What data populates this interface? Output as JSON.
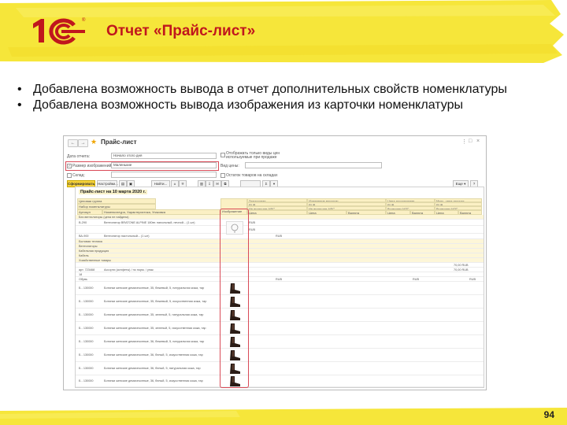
{
  "slide": {
    "title": "Отчет «Прайс-лист»",
    "bullets": [
      "Добавлена возможность вывода в отчет дополнительных свойств номенклатуры",
      "Добавлена возможность вывода изображения из карточки номенклатуры"
    ],
    "page_number": "94"
  },
  "colors": {
    "title": "#c0171d",
    "highlight_band": "#f6e63a",
    "logo_red": "#c0171d",
    "annotation": "#d94a57"
  },
  "logo": {
    "text": "1С"
  },
  "window": {
    "title": "Прайс-лист",
    "nav": {
      "back": "←",
      "forward": "→"
    },
    "controls": {
      "menu": "⋮",
      "restore": "□",
      "close": "×"
    },
    "filters": {
      "date_label": "Дата отчета:",
      "date_value": "Начало этого дня",
      "image_size_label": "Размер изображений:",
      "image_size_value": "Маленькие",
      "warehouse_label": "Склад:",
      "option1": "Отображать только виды цен используемые при продаже",
      "price_type_label": "Вид цены:",
      "option2": "Остаток товаров на складах"
    },
    "toolbar": {
      "generate": "Сформировать",
      "settings": "Настройки...",
      "find": "Найти...",
      "sum_symbol": "Σ",
      "more": "Еще ▾",
      "help": "?"
    },
    "report": {
      "title": "Прайс-лист на 10 марта 2020 г.",
      "headers": {
        "c1": [
          "Ценовая группа",
          "Набор номенклатуры",
          "Артикул"
        ],
        "c2": [
          "",
          "",
          "Номенклатура, Характеристика, Упаковка"
        ],
        "c3": [
          "",
          "",
          "Изображение"
        ],
        "c4": [
          "Закупочная",
          "RUB",
          "Не включает НДС",
          "Цена"
        ],
        "c5": [
          "Изменение вручную",
          "RUB",
          "Не включает НДС",
          "Цена"
        ],
        "c6": [
          "",
          "",
          "",
          "Валюта"
        ],
        "c7": [
          "Цена поступления",
          "RUB",
          "Включает НДС",
          "Цена"
        ],
        "c8": [
          "",
          "",
          "",
          "Валюта"
        ],
        "c9": [
          "Макс. цена продаж",
          "RUB",
          "Включает НДС",
          "Цена"
        ],
        "c10": [
          "",
          "",
          "",
          "Валюта"
        ]
      },
      "rows": [
        {
          "c1": "Без вентиляторы (цена не найдена)",
          "c2": "",
          "c4": "",
          "c7": "",
          "group": true
        },
        {
          "c1": "В-290",
          "c2": "Вентилятор BRATONE ALPINE 180вт. напольный, печной... (1 шт)",
          "c4": "RUB",
          "c7": "",
          "group": false
        },
        {
          "c1": "",
          "c2": "",
          "c4": "RUB",
          "c7": "",
          "group": false
        },
        {
          "c1": "ВА-900",
          "c2": "Вентилятор настольный... (1 шт)",
          "c4": "RUB",
          "c7": "",
          "group": false
        },
        {
          "c1": "Бытовая техника",
          "c2": "",
          "c4": "",
          "c7": "",
          "group": true
        },
        {
          "c1": "Вентиляторы",
          "c2": "",
          "c4": "",
          "c7": "",
          "group": true
        },
        {
          "c1": "Кабельная продукция",
          "c2": "",
          "c4": "",
          "c7": "",
          "group": true
        },
        {
          "c1": "Кабель",
          "c2": "",
          "c4": "",
          "c7": "",
          "group": true
        },
        {
          "c1": "Хозяйственные товары",
          "c2": "",
          "c4": "",
          "c7": "",
          "group": true
        },
        {
          "c1": "",
          "c2": "",
          "c4": "",
          "c7": "",
          "c9": "70,00 RUB",
          "group": false
        },
        {
          "c1": "арт. 723468",
          "c2": "Ассорти (конфеты) / по норм. / упак",
          "c4": "",
          "c7": "",
          "c9": "70,00 RUB",
          "group": false
        },
        {
          "c1": "18",
          "c2": "",
          "c4": "",
          "c7": "",
          "group": false
        },
        {
          "c1": "Обувь",
          "c2": "",
          "c4": "RUB",
          "c7": "RUB",
          "c9": "RUB",
          "group": false
        },
        {
          "c1": "Б - 130000",
          "c2": "Ботинки женские демисезонные, 35, бежевый, 5, натуральная кожа, тар",
          "group": false
        },
        {
          "c1": "Б - 130000",
          "c2": "Ботинки женские демисезонные, 35, бежевый, 5, искусственная кожа, тар",
          "group": false
        },
        {
          "c1": "Б - 130000",
          "c2": "Ботинки женские демисезонные, 35, зеленый, 5, натуральная кожа, тар",
          "group": false
        },
        {
          "c1": "Б - 130000",
          "c2": "Ботинки женские демисезонные, 35, зеленый, 5, искусственная кожа, тар",
          "group": false
        },
        {
          "c1": "Б - 130000",
          "c2": "Ботинки женские демисезонные, 36, бежевый, 5, натуральная кожа, тар",
          "group": false
        },
        {
          "c1": "Б - 130000",
          "c2": "Ботинки женские демисезонные, 36, белый, 5, искусственная кожа, тар",
          "group": false
        },
        {
          "c1": "Б - 130000",
          "c2": "Ботинки женские демисезонные, 36, белый, 5, натуральная кожа, тар",
          "group": false
        },
        {
          "c1": "Б - 130000",
          "c2": "Ботинки женские демисезонные, 36, белый, 5, искусственная кожа, тар",
          "group": false
        }
      ]
    }
  }
}
